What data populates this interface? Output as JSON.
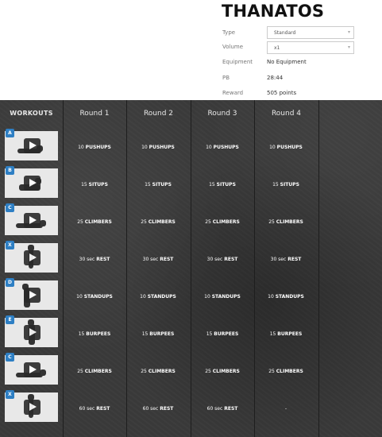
{
  "workout": {
    "title": "THANATOS",
    "fields": {
      "type_label": "Type",
      "type_value": "Standard",
      "volume_label": "Volume",
      "volume_value": "x1",
      "equipment_label": "Equipment",
      "equipment_value": "No Equipment",
      "pb_label": "PB",
      "pb_value": "28:44",
      "reward_label": "Reward",
      "reward_value": "505 points"
    }
  },
  "table": {
    "headers": [
      "WORKOUTS",
      "Round 1",
      "Round 2",
      "Round 3",
      "Round 4"
    ],
    "rows": [
      {
        "badge": "A",
        "cells": [
          [
            "10",
            "PUSHUPS"
          ],
          [
            "10",
            "PUSHUPS"
          ],
          [
            "10",
            "PUSHUPS"
          ],
          [
            "10",
            "PUSHUPS"
          ]
        ]
      },
      {
        "badge": "B",
        "cells": [
          [
            "15",
            "SITUPS"
          ],
          [
            "15",
            "SITUPS"
          ],
          [
            "15",
            "SITUPS"
          ],
          [
            "15",
            "SITUPS"
          ]
        ]
      },
      {
        "badge": "C",
        "cells": [
          [
            "25",
            "CLIMBERS"
          ],
          [
            "25",
            "CLIMBERS"
          ],
          [
            "25",
            "CLIMBERS"
          ],
          [
            "25",
            "CLIMBERS"
          ]
        ]
      },
      {
        "badge": "X",
        "cells": [
          [
            "30 sec",
            "REST"
          ],
          [
            "30 sec",
            "REST"
          ],
          [
            "30 sec",
            "REST"
          ],
          [
            "30 sec",
            "REST"
          ]
        ]
      },
      {
        "badge": "D",
        "cells": [
          [
            "10",
            "STANDUPS"
          ],
          [
            "10",
            "STANDUPS"
          ],
          [
            "10",
            "STANDUPS"
          ],
          [
            "10",
            "STANDUPS"
          ]
        ]
      },
      {
        "badge": "E",
        "cells": [
          [
            "15",
            "BURPEES"
          ],
          [
            "15",
            "BURPEES"
          ],
          [
            "15",
            "BURPEES"
          ],
          [
            "15",
            "BURPEES"
          ]
        ]
      },
      {
        "badge": "C",
        "cells": [
          [
            "25",
            "CLIMBERS"
          ],
          [
            "25",
            "CLIMBERS"
          ],
          [
            "25",
            "CLIMBERS"
          ],
          [
            "25",
            "CLIMBERS"
          ]
        ]
      },
      {
        "badge": "X",
        "cells": [
          [
            "60 sec",
            "REST"
          ],
          [
            "60 sec",
            "REST"
          ],
          [
            "60 sec",
            "REST"
          ],
          [
            "-",
            ""
          ]
        ]
      }
    ]
  },
  "colors": {
    "badge": "#2e7fc4",
    "board": "#3a3a3a"
  }
}
